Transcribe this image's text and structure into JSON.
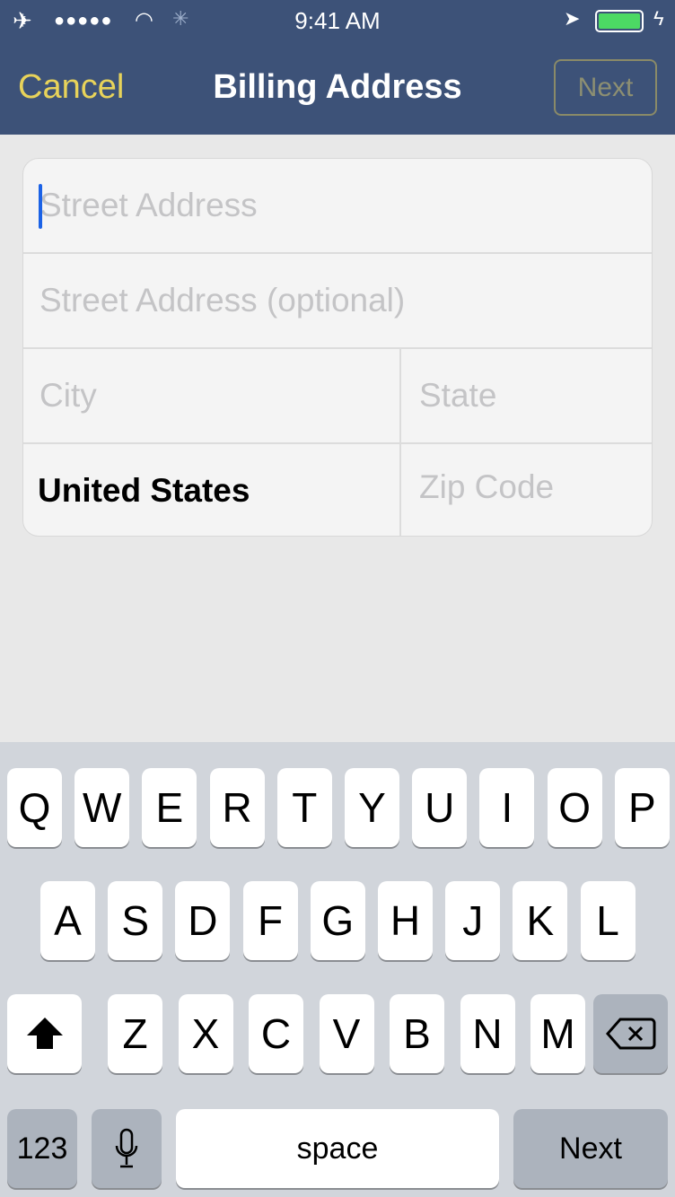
{
  "status_bar": {
    "time": "9:41 AM",
    "icons": [
      "airplane-icon",
      "signal-dots-icon",
      "wifi-icon",
      "activity-spinner-icon",
      "location-arrow-icon",
      "battery-icon",
      "charging-bolt-icon"
    ],
    "battery_color": "#4cd964"
  },
  "nav": {
    "cancel": "Cancel",
    "title": "Billing Address",
    "next": "Next",
    "bg": "#3d5278",
    "accent": "#e8d35a"
  },
  "form": {
    "street": {
      "placeholder": "Street Address",
      "value": ""
    },
    "street2": {
      "placeholder": "Street Address (optional)",
      "value": ""
    },
    "city": {
      "placeholder": "City",
      "value": ""
    },
    "state": {
      "placeholder": "State",
      "value": ""
    },
    "country": {
      "value": "United States"
    },
    "zip": {
      "placeholder": "Zip Code",
      "value": ""
    }
  },
  "keyboard": {
    "row1": [
      "Q",
      "W",
      "E",
      "R",
      "T",
      "Y",
      "U",
      "I",
      "O",
      "P"
    ],
    "row2": [
      "A",
      "S",
      "D",
      "F",
      "G",
      "H",
      "J",
      "K",
      "L"
    ],
    "row3": [
      "Z",
      "X",
      "C",
      "V",
      "B",
      "N",
      "M"
    ],
    "numbers": "123",
    "space": "space",
    "return": "Next"
  }
}
